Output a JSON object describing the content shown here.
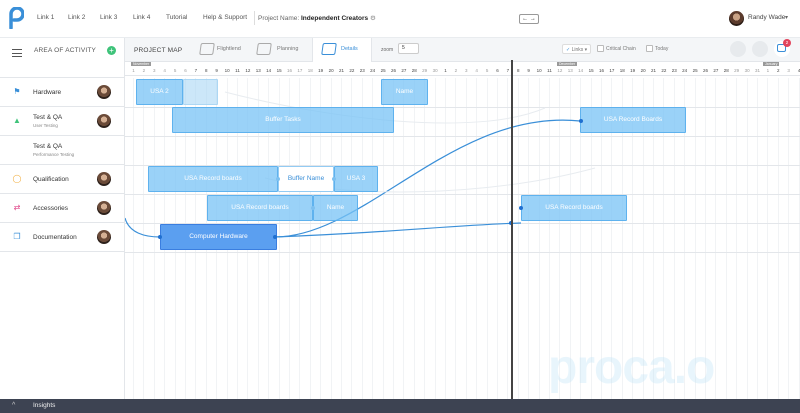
{
  "topbar": {
    "nav": [
      "Link 1",
      "Link 2",
      "Link 3",
      "Link 4",
      "Tutorial",
      "Help & Support"
    ],
    "project_label": "Project Name:",
    "project_name": "Independent Creators",
    "arrows": "← →",
    "user_name": "Randy Wade"
  },
  "sidebar": {
    "title": "AREA OF ACTIVITY",
    "rows": [
      {
        "label": "Hardware",
        "sub": "",
        "icon": "flag-icon",
        "icon_color": "#3a8fd8"
      },
      {
        "label": "Test & QA",
        "sub": "User Testing",
        "icon": "flask-icon",
        "icon_color": "#3fc37a"
      },
      {
        "label": "Test & QA",
        "sub": "Performance Testing",
        "icon": "",
        "icon_color": ""
      },
      {
        "label": "Qualification",
        "sub": "",
        "icon": "bulb-icon",
        "icon_color": "#f0a830"
      },
      {
        "label": "Accessories",
        "sub": "",
        "icon": "shuffle-icon",
        "icon_color": "#e0478a"
      },
      {
        "label": "Documentation",
        "sub": "",
        "icon": "copy-icon",
        "icon_color": "#3a8fd8"
      }
    ]
  },
  "toolbar": {
    "title": "PROJECT MAP",
    "tabs": [
      "Flightlend",
      "Planning",
      "Details"
    ],
    "zoom_label": "zoom",
    "zoom_value": "5",
    "links_label": "Links",
    "critical_chain": "Critical Chain",
    "today": "Today",
    "notif_count": "2"
  },
  "timeline": {
    "months": [
      "November",
      "December",
      "January"
    ],
    "days": [
      "1",
      "2",
      "3",
      "4",
      "5",
      "6",
      "7",
      "8",
      "9",
      "10",
      "11",
      "12",
      "13",
      "14",
      "15",
      "16",
      "17",
      "18",
      "19",
      "20",
      "21",
      "22",
      "23",
      "24",
      "25",
      "26",
      "27",
      "28",
      "29",
      "30",
      "1",
      "2",
      "3",
      "4",
      "5",
      "6",
      "7",
      "8",
      "9",
      "10",
      "11",
      "12",
      "13",
      "14",
      "15",
      "16",
      "17",
      "18",
      "19",
      "20",
      "21",
      "22",
      "23",
      "24",
      "25",
      "26",
      "27",
      "28",
      "29",
      "30",
      "31",
      "1",
      "2",
      "3",
      "4",
      "5",
      "6"
    ]
  },
  "bars": [
    {
      "label": "USA 2"
    },
    {
      "label": ""
    },
    {
      "label": "Name"
    },
    {
      "label": "Buffer Tasks"
    },
    {
      "label": "USA Record Boards"
    },
    {
      "label": "USA Record boards"
    },
    {
      "label": "Buffer Name"
    },
    {
      "label": "USA 3"
    },
    {
      "label": "USA Record boards"
    },
    {
      "label": "Name"
    },
    {
      "label": "USA Record boards"
    },
    {
      "label": "Computer Hardware"
    }
  ],
  "watermark": "proca.o",
  "footer": {
    "caret": "^",
    "label": "Insights"
  }
}
